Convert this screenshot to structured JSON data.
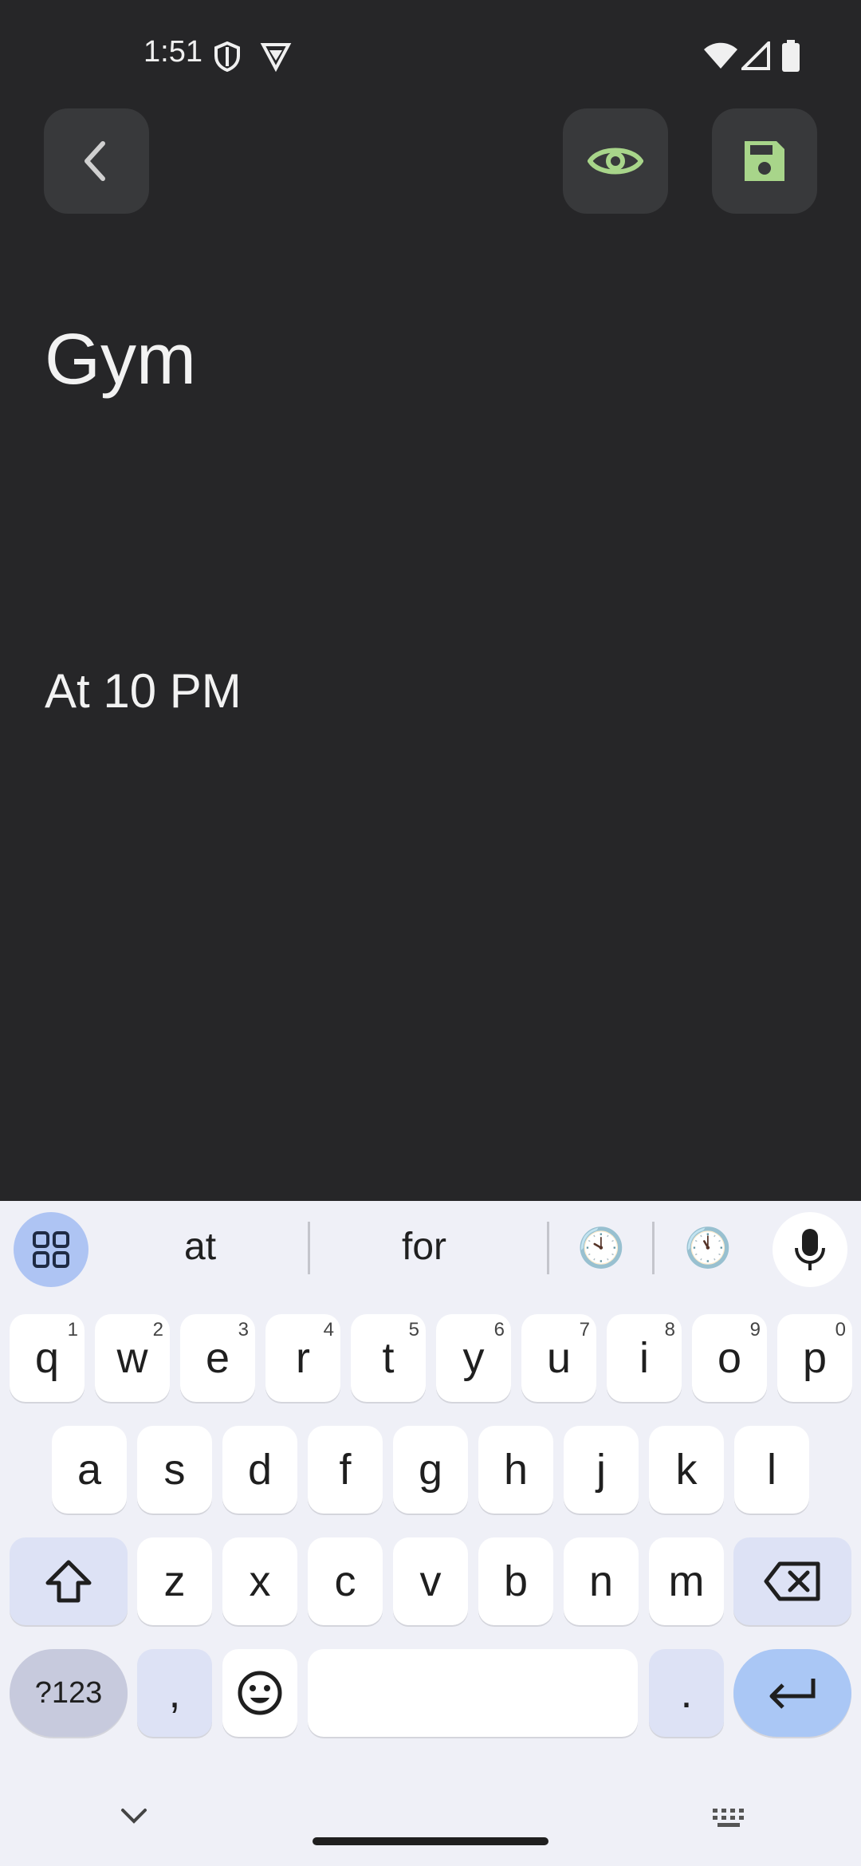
{
  "status_bar": {
    "time": "1:51",
    "left_icons": [
      "shield-icon",
      "vpn-icon"
    ],
    "right_icons": [
      "wifi-icon",
      "signal-icon",
      "battery-icon"
    ]
  },
  "toolbar": {
    "back_icon": "chevron-left-icon",
    "preview_icon": "eye-icon",
    "save_icon": "floppy-disk-icon",
    "accent_color": "#a8d58a",
    "button_bg": "#38393b"
  },
  "note": {
    "title": "Gym",
    "body": "At 10 PM"
  },
  "keyboard": {
    "suggestions": [
      "at",
      "for",
      "🕙",
      "🕚"
    ],
    "row1": [
      {
        "key": "q",
        "hint": "1"
      },
      {
        "key": "w",
        "hint": "2"
      },
      {
        "key": "e",
        "hint": "3"
      },
      {
        "key": "r",
        "hint": "4"
      },
      {
        "key": "t",
        "hint": "5"
      },
      {
        "key": "y",
        "hint": "6"
      },
      {
        "key": "u",
        "hint": "7"
      },
      {
        "key": "i",
        "hint": "8"
      },
      {
        "key": "o",
        "hint": "9"
      },
      {
        "key": "p",
        "hint": "0"
      }
    ],
    "row2": [
      "a",
      "s",
      "d",
      "f",
      "g",
      "h",
      "j",
      "k",
      "l"
    ],
    "row3": [
      "z",
      "x",
      "c",
      "v",
      "b",
      "n",
      "m"
    ],
    "symbols_label": "?123",
    "comma_label": ",",
    "period_label": ".",
    "emoji_icon": "emoji-icon",
    "shift_icon": "shift-icon",
    "backspace_icon": "backspace-icon",
    "enter_icon": "enter-icon",
    "mic_icon": "microphone-icon",
    "apps_icon": "apps-grid-icon"
  },
  "nav_bar": {
    "hide_keyboard_icon": "chevron-down-icon",
    "keyboard_switch_icon": "keyboard-icon"
  }
}
